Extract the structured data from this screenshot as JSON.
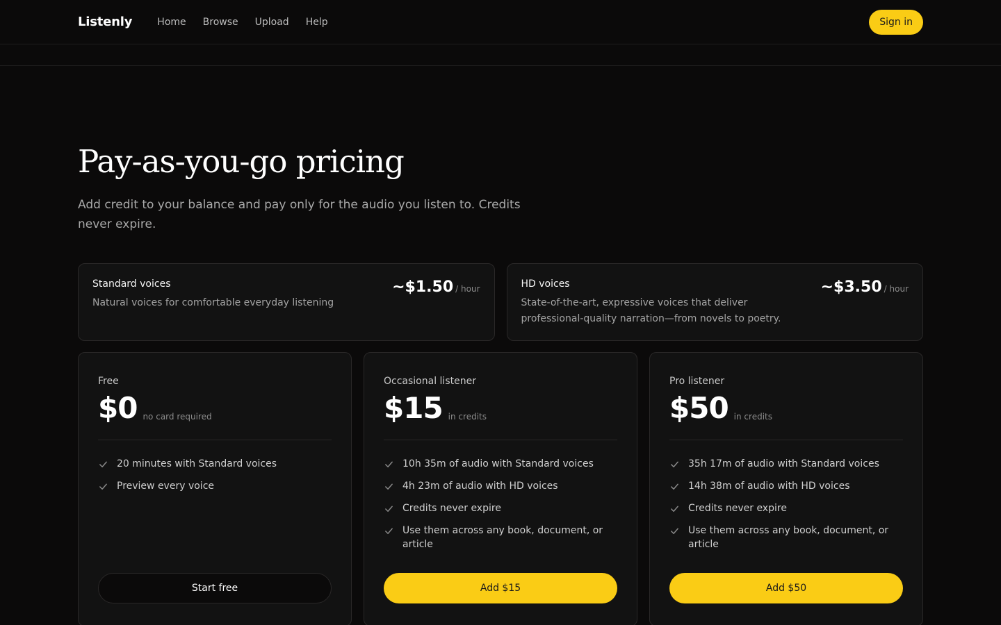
{
  "app": {
    "name": "Listenly",
    "nav": [
      "Home",
      "Browse",
      "Upload",
      "Help"
    ],
    "sign_in": "Sign in"
  },
  "hero": {
    "title": "Pay-as-you-go pricing",
    "subtitle": "Add credit to your balance and pay only for the audio you listen to. Credits never expire."
  },
  "voices": [
    {
      "title": "Standard voices",
      "description": "Natural voices for comfortable everyday listening",
      "price": "~$1.50",
      "unit": "/ hour"
    },
    {
      "title": "HD voices",
      "description": "State-of-the-art, expressive voices that deliver professional-quality narration—from novels to poetry.",
      "price": "~$3.50",
      "unit": "/ hour"
    }
  ],
  "plans": [
    {
      "name": "Free",
      "price": "$0",
      "note": "no card required",
      "features": [
        "20 minutes with Standard voices",
        "Preview every voice"
      ],
      "cta": "Start free"
    },
    {
      "name": "Occasional listener",
      "price": "$15",
      "note": "in credits",
      "features": [
        "10h 35m of audio with Standard voices",
        "4h 23m of audio with HD voices",
        "Credits never expire",
        "Use them across any book, document, or article"
      ],
      "cta": "Add $15"
    },
    {
      "name": "Pro listener",
      "price": "$50",
      "note": "in credits",
      "features": [
        "35h 17m of audio with Standard voices",
        "14h 38m of audio with HD voices",
        "Credits never expire",
        "Use them across any book, document, or article"
      ],
      "cta": "Add $50"
    }
  ],
  "colors": {
    "accent": "#facc15",
    "background": "#0b0a0a",
    "card": "#121212"
  },
  "icons": {
    "feature": "check-icon"
  }
}
